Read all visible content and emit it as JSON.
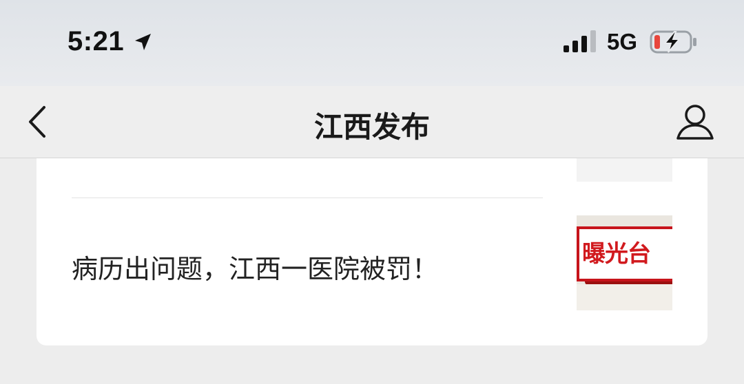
{
  "status_bar": {
    "time": "5:21",
    "network": "5G",
    "icons": [
      "location-arrow-icon",
      "cellular-signal-icon",
      "battery-charging-icon"
    ],
    "battery_color": "#e8463c"
  },
  "nav": {
    "title": "江西发布",
    "back_icon": "chevron-left-icon",
    "profile_icon": "person-icon"
  },
  "article": {
    "title": "病历出问题，江西一医院被罚！",
    "thumbnail_text": "曝光台",
    "thumbnail_accent": "#d11a1e"
  }
}
